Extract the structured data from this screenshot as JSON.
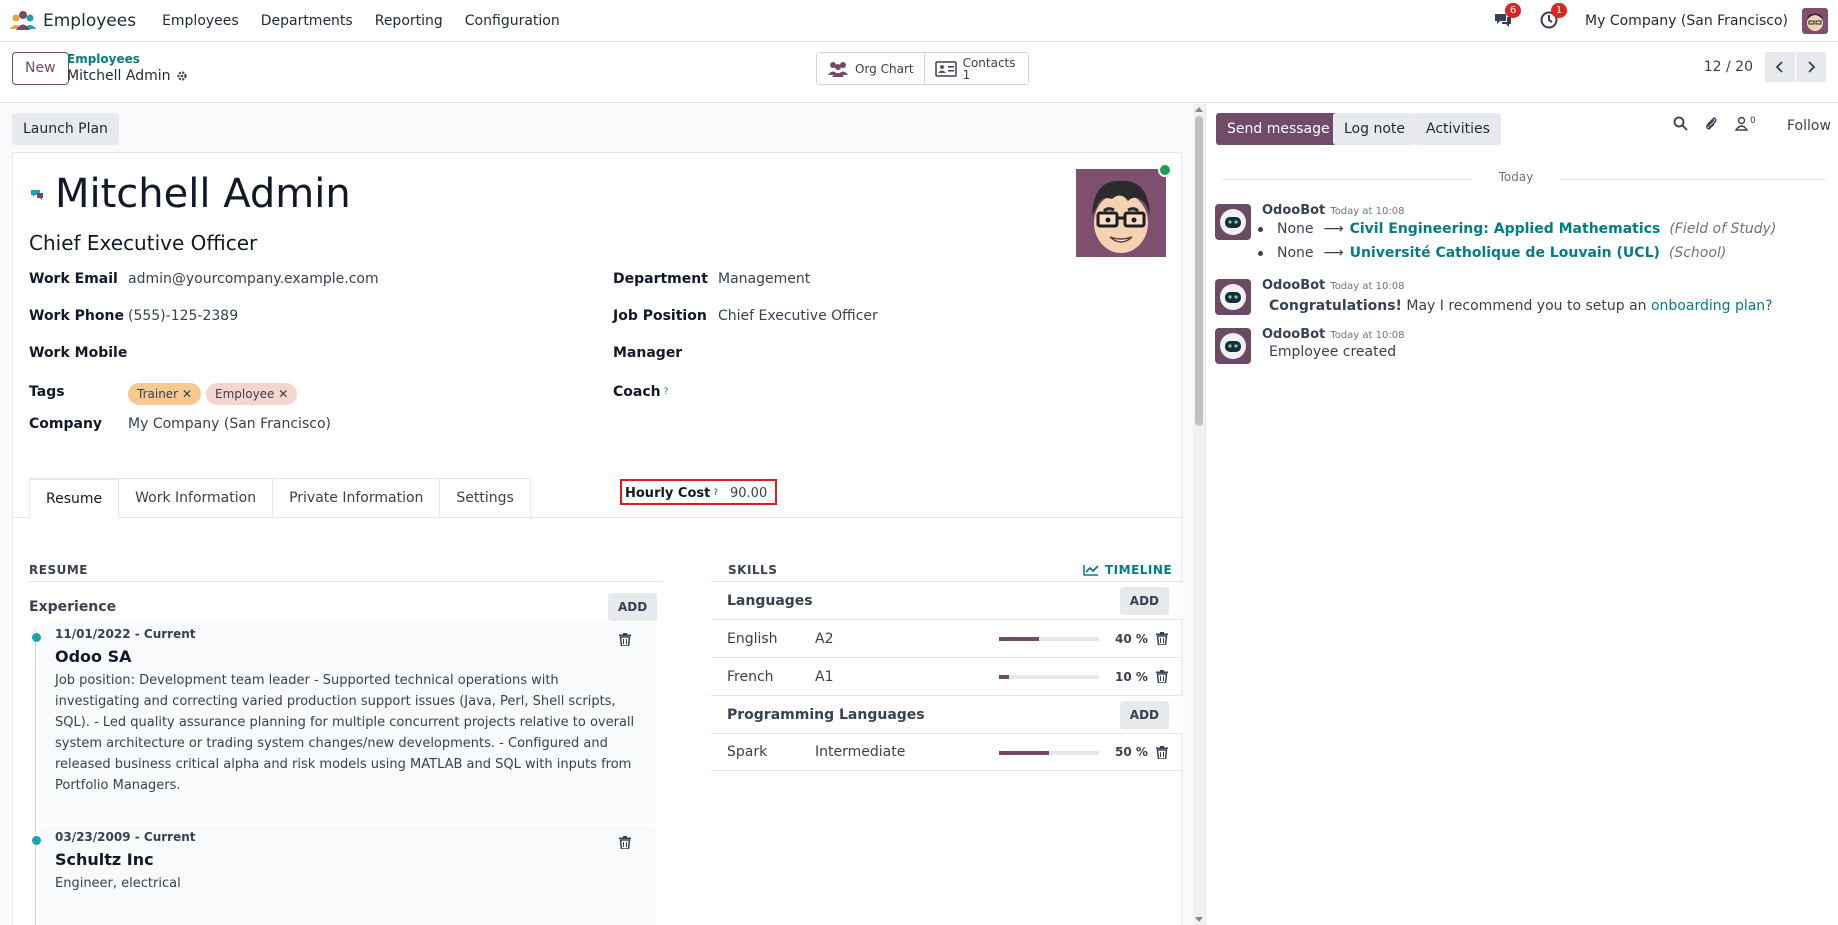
{
  "topnav": {
    "app_name": "Employees",
    "menu": [
      "Employees",
      "Departments",
      "Reporting",
      "Configuration"
    ],
    "messages_badge": "6",
    "activities_badge": "1",
    "company": "My Company (San Francisco)"
  },
  "control": {
    "new_label": "New",
    "breadcrumb_parent": "Employees",
    "breadcrumb_current": "Mitchell Admin",
    "org_chart_label": "Org Chart",
    "contacts_label": "Contacts",
    "contacts_count": "1",
    "pager": "12 / 20"
  },
  "form": {
    "launch_plan_label": "Launch Plan",
    "name": "Mitchell Admin",
    "job_title": "Chief Executive Officer",
    "left_fields": [
      {
        "label": "Work Email",
        "value": "admin@yourcompany.example.com"
      },
      {
        "label": "Work Phone",
        "value": "(555)-125-2389"
      },
      {
        "label": "Work Mobile",
        "value": ""
      },
      {
        "label": "Tags",
        "value": ""
      },
      {
        "label": "Company",
        "value": "My Company (San Francisco)"
      }
    ],
    "tags": [
      {
        "label": "Trainer",
        "color": "#f8c893"
      },
      {
        "label": "Employee",
        "color": "#f4d6cf"
      }
    ],
    "right_fields": [
      {
        "label": "Department",
        "value": "Management"
      },
      {
        "label": "Job Position",
        "value": "Chief Executive Officer"
      },
      {
        "label": "Manager",
        "value": ""
      },
      {
        "label": "Coach",
        "value": ""
      },
      {
        "label": "Hourly Cost",
        "value": "90.00"
      }
    ],
    "help_mark": "?",
    "tabs": [
      "Resume",
      "Work Information",
      "Private Information",
      "Settings"
    ]
  },
  "resume": {
    "title": "RESUME",
    "experience_label": "Experience",
    "add_label": "ADD",
    "items": [
      {
        "date": "11/01/2022 - Current",
        "company": "Odoo SA",
        "description": "Job position: Development team leader - Supported technical operations with investigating and correcting varied production support issues (Java, Perl, Shell scripts, SQL). - Led quality assurance planning for multiple concurrent projects relative to overall system architecture or trading system changes/new developments. - Configured and released business critical alpha and risk models using MATLAB and SQL with inputs from Portfolio Managers."
      },
      {
        "date": "03/23/2009 - Current",
        "company": "Schultz Inc",
        "description": "Engineer, electrical"
      }
    ]
  },
  "skills": {
    "title": "SKILLS",
    "timeline_label": "TIMELINE",
    "add_label": "ADD",
    "groups": [
      {
        "name": "Languages",
        "rows": [
          {
            "skill": "English",
            "level": "A2",
            "progress": 40,
            "pct_label": "40 %"
          },
          {
            "skill": "French",
            "level": "A1",
            "progress": 10,
            "pct_label": "10 %"
          }
        ]
      },
      {
        "name": "Programming Languages",
        "rows": [
          {
            "skill": "Spark",
            "level": "Intermediate",
            "progress": 50,
            "pct_label": "50 %"
          }
        ]
      }
    ]
  },
  "chatter": {
    "send_message": "Send message",
    "log_note": "Log note",
    "activities": "Activities",
    "followers_count": "0",
    "follow_label": "Follow",
    "today_label": "Today",
    "messages": [
      {
        "author": "OdooBot",
        "time": "Today at 10:08",
        "tracking": [
          {
            "old": "None",
            "new": "Civil Engineering: Applied Mathematics",
            "field": "(Field of Study)"
          },
          {
            "old": "None",
            "new": "Université Catholique de Louvain (UCL)",
            "field": "(School)"
          }
        ]
      },
      {
        "author": "OdooBot",
        "time": "Today at 10:08",
        "bold": "Congratulations!",
        "text": " May I recommend you to setup an ",
        "link": "onboarding plan?"
      },
      {
        "author": "OdooBot",
        "time": "Today at 10:08",
        "text": "Employee created"
      }
    ]
  }
}
